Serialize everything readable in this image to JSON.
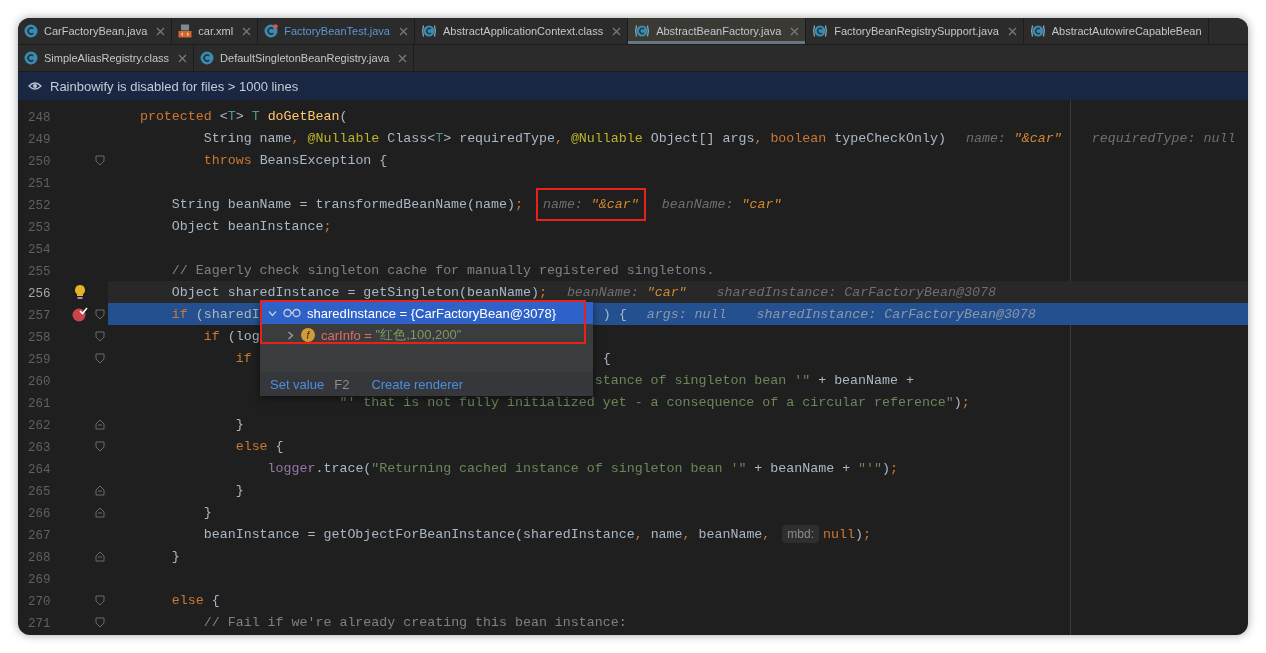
{
  "tabs": [
    {
      "label": "CarFactoryBean.java",
      "kind": "java",
      "modified": false,
      "selected": false,
      "closable": true
    },
    {
      "label": "car.xml",
      "kind": "xml",
      "modified": false,
      "selected": false,
      "closable": true
    },
    {
      "label": "FactoryBeanTest.java",
      "kind": "test",
      "modified": true,
      "selected": false,
      "closable": true
    },
    {
      "label": "AbstractApplicationContext.class",
      "kind": "class",
      "modified": false,
      "selected": false,
      "closable": true
    },
    {
      "label": "AbstractBeanFactory.java",
      "kind": "class",
      "modified": false,
      "selected": true,
      "closable": true
    },
    {
      "label": "FactoryBeanRegistrySupport.java",
      "kind": "class",
      "modified": false,
      "selected": false,
      "closable": true
    },
    {
      "label": "AbstractAutowireCapableBean",
      "kind": "class",
      "modified": false,
      "selected": false,
      "closable": false
    }
  ],
  "tabs_row_2": [
    {
      "label": "SimpleAliasRegistry.class",
      "kind": "java",
      "modified": false,
      "selected": false,
      "closable": true
    },
    {
      "label": "DefaultSingletonBeanRegistry.java",
      "kind": "java",
      "modified": false,
      "selected": false,
      "closable": true
    }
  ],
  "banner": {
    "text": "Rainbowify is disabled for files > 1000 lines"
  },
  "lines": [
    {
      "number": "248",
      "segments": [
        {
          "kind": "code",
          "tokens": [
            {
              "kind": "kw",
              "text": "    protected"
            },
            {
              "kind": "plain",
              "text": " <"
            },
            {
              "kind": "tparam",
              "text": "T"
            },
            {
              "kind": "plain",
              "text": "> "
            },
            {
              "kind": "tparam",
              "text": "T"
            },
            {
              "kind": "method",
              "text": " doGetBean"
            },
            {
              "kind": "plain",
              "text": "("
            }
          ]
        }
      ]
    },
    {
      "number": "249",
      "segments": [
        {
          "kind": "code",
          "tokens": [
            {
              "kind": "plain",
              "text": "            String name"
            },
            {
              "kind": "punc",
              "text": ", "
            },
            {
              "kind": "ann",
              "text": "@Nullable"
            },
            {
              "kind": "plain",
              "text": " Class<"
            },
            {
              "kind": "tparam",
              "text": "T"
            },
            {
              "kind": "plain",
              "text": "> requiredType"
            },
            {
              "kind": "punc",
              "text": ", "
            },
            {
              "kind": "ann",
              "text": "@Nullable"
            },
            {
              "kind": "plain",
              "text": " Object[] args"
            },
            {
              "kind": "punc",
              "text": ", "
            },
            {
              "kind": "kw",
              "text": "boolean"
            },
            {
              "kind": "plain",
              "text": " typeCheckOnly)"
            }
          ]
        },
        {
          "kind": "hint",
          "label": "name:",
          "value": "\"&car\"",
          "string_value": true
        },
        {
          "kind": "hint",
          "label": "requiredType:",
          "value": "null",
          "string_value": false
        }
      ]
    },
    {
      "number": "250",
      "fold_start": true,
      "segments": [
        {
          "kind": "code",
          "tokens": [
            {
              "kind": "kw",
              "text": "            throws"
            },
            {
              "kind": "plain",
              "text": " BeansException {"
            }
          ]
        }
      ]
    },
    {
      "number": "251"
    },
    {
      "number": "252",
      "segments": [
        {
          "kind": "code",
          "tokens": [
            {
              "kind": "plain",
              "text": "        String beanName = transformedBeanName(name)"
            },
            {
              "kind": "punc",
              "text": ";"
            }
          ]
        },
        {
          "kind": "hint",
          "label": "name:",
          "value": "\"&car\"",
          "string_value": true,
          "boxed": true
        },
        {
          "kind": "hint",
          "label": "beanName:",
          "value": "\"car\"",
          "string_value": true
        }
      ]
    },
    {
      "number": "253",
      "segments": [
        {
          "kind": "code",
          "tokens": [
            {
              "kind": "plain",
              "text": "        Object beanInstance"
            },
            {
              "kind": "punc",
              "text": ";"
            }
          ]
        }
      ]
    },
    {
      "number": "254"
    },
    {
      "number": "255",
      "segments": [
        {
          "kind": "code",
          "tokens": [
            {
              "kind": "comment",
              "text": "        // Eagerly check singleton cache for manually registered singletons."
            }
          ]
        }
      ]
    },
    {
      "number": "256",
      "current": true,
      "intention_bulb": true,
      "segments": [
        {
          "kind": "code",
          "tokens": [
            {
              "kind": "plain",
              "text": "        Object sharedInstance = getSingleton(beanName)"
            },
            {
              "kind": "punc",
              "text": ";"
            }
          ]
        },
        {
          "kind": "hint",
          "label": "beanName:",
          "value": "\"car\"",
          "string_value": true
        },
        {
          "kind": "hint",
          "label": "sharedInstance:",
          "value": "CarFactoryBean@3078",
          "string_value": false
        }
      ]
    },
    {
      "number": "257",
      "paused": true,
      "breakpoint": true,
      "fold_start": true,
      "segments": [
        {
          "kind": "code",
          "tokens": [
            {
              "kind": "kw",
              "text": "        if"
            },
            {
              "kind": "plain",
              "text": " (sharedI"
            }
          ]
        },
        {
          "kind": "code",
          "tokens": [
            {
              "kind": "plain",
              "text": "                                           ) {"
            }
          ]
        },
        {
          "kind": "hint",
          "label": "args:",
          "value": "null",
          "string_value": false
        },
        {
          "kind": "hint",
          "label": "sharedInstance:",
          "value": "CarFactoryBean@3078",
          "string_value": false
        }
      ]
    },
    {
      "number": "258",
      "fold_start": true,
      "segments": [
        {
          "kind": "code",
          "tokens": [
            {
              "kind": "kw",
              "text": "            if"
            },
            {
              "kind": "plain",
              "text": " (log"
            }
          ]
        }
      ]
    },
    {
      "number": "259",
      "fold_start": true,
      "segments": [
        {
          "kind": "code",
          "tokens": [
            {
              "kind": "kw",
              "text": "                if"
            }
          ]
        },
        {
          "kind": "code",
          "tokens": [
            {
              "kind": "plain",
              "text": "                                            {"
            }
          ]
        }
      ]
    },
    {
      "number": "260",
      "segments": [
        {
          "kind": "code",
          "tokens": [
            {
              "kind": "str",
              "text": "                                                             stance of singleton bean '\""
            },
            {
              "kind": "plain",
              "text": " + beanName +"
            }
          ]
        }
      ]
    },
    {
      "number": "261",
      "segments": [
        {
          "kind": "code",
          "tokens": [
            {
              "kind": "str",
              "text": "                             \"' that is not fully initialized yet - a consequence of a circular reference\""
            },
            {
              "kind": "plain",
              "text": ")"
            },
            {
              "kind": "punc",
              "text": ";"
            }
          ]
        }
      ]
    },
    {
      "number": "262",
      "fold_end": true,
      "segments": [
        {
          "kind": "code",
          "tokens": [
            {
              "kind": "plain",
              "text": "                }"
            }
          ]
        }
      ]
    },
    {
      "number": "263",
      "fold_start": true,
      "segments": [
        {
          "kind": "code",
          "tokens": [
            {
              "kind": "kw",
              "text": "                else"
            },
            {
              "kind": "plain",
              "text": " {"
            }
          ]
        }
      ]
    },
    {
      "number": "264",
      "segments": [
        {
          "kind": "code",
          "tokens": [
            {
              "kind": "field",
              "text": "                    logger"
            },
            {
              "kind": "plain",
              "text": ".trace("
            },
            {
              "kind": "str",
              "text": "\"Returning cached instance of singleton bean '\""
            },
            {
              "kind": "plain",
              "text": " + beanName + "
            },
            {
              "kind": "str",
              "text": "\"'\""
            },
            {
              "kind": "plain",
              "text": ")"
            },
            {
              "kind": "punc",
              "text": ";"
            }
          ]
        }
      ]
    },
    {
      "number": "265",
      "fold_end": true,
      "segments": [
        {
          "kind": "code",
          "tokens": [
            {
              "kind": "plain",
              "text": "                }"
            }
          ]
        }
      ]
    },
    {
      "number": "266",
      "fold_end": true,
      "segments": [
        {
          "kind": "code",
          "tokens": [
            {
              "kind": "plain",
              "text": "            }"
            }
          ]
        }
      ]
    },
    {
      "number": "267",
      "segments": [
        {
          "kind": "code",
          "tokens": [
            {
              "kind": "plain",
              "text": "            beanInstance = getObjectForBeanInstance(sharedInstance"
            },
            {
              "kind": "punc",
              "text": ", "
            },
            {
              "kind": "plain",
              "text": "name"
            },
            {
              "kind": "punc",
              "text": ", "
            },
            {
              "kind": "plain",
              "text": "beanName"
            },
            {
              "kind": "punc",
              "text": ","
            }
          ]
        },
        {
          "kind": "param",
          "text": "mbd:"
        },
        {
          "kind": "code",
          "tokens": [
            {
              "kind": "kw",
              "text": "null"
            },
            {
              "kind": "plain",
              "text": ")"
            },
            {
              "kind": "punc",
              "text": ";"
            }
          ]
        }
      ]
    },
    {
      "number": "268",
      "fold_end": true,
      "segments": [
        {
          "kind": "code",
          "tokens": [
            {
              "kind": "plain",
              "text": "        }"
            }
          ]
        }
      ]
    },
    {
      "number": "269"
    },
    {
      "number": "270",
      "fold_start": true,
      "segments": [
        {
          "kind": "code",
          "tokens": [
            {
              "kind": "kw",
              "text": "        else"
            },
            {
              "kind": "plain",
              "text": " {"
            }
          ]
        }
      ]
    },
    {
      "number": "271",
      "fold_start": true,
      "segments": [
        {
          "kind": "code",
          "tokens": [
            {
              "kind": "comment",
              "text": "            // Fail if we're already creating this bean instance:"
            }
          ]
        }
      ]
    }
  ],
  "debug_popup": {
    "annotated": true,
    "rows": [
      {
        "kind": "object",
        "name": "sharedInstance",
        "operator": "=",
        "value": "{CarFactoryBean@3078}",
        "expanded": true,
        "selected": true
      },
      {
        "kind": "field",
        "badge": "f",
        "name": "carInfo",
        "operator": "=",
        "value": "\"红色,100,200\"",
        "expanded": false,
        "selected": false
      }
    ],
    "actions": [
      {
        "label": "Set value",
        "shortcut": "F2"
      },
      {
        "label": "Create renderer"
      }
    ]
  }
}
